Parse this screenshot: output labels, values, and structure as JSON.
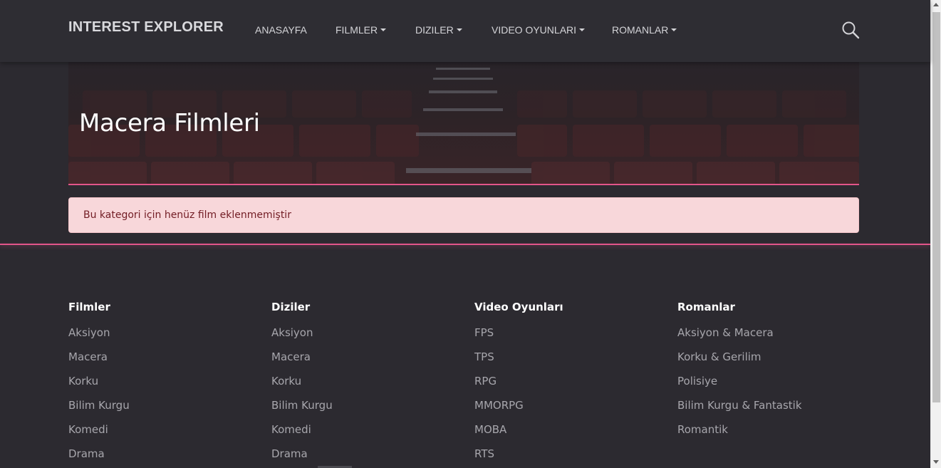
{
  "navbar": {
    "brand": "INTEREST EXPLORER",
    "items": [
      {
        "label": "ANASAYFA",
        "dropdown": false
      },
      {
        "label": "FILMLER",
        "dropdown": true
      },
      {
        "label": "DIZILER",
        "dropdown": true
      },
      {
        "label": "VIDEO OYUNLARI",
        "dropdown": true
      },
      {
        "label": "ROMANLAR",
        "dropdown": true
      }
    ],
    "search_icon": "search-icon"
  },
  "hero": {
    "title": "Macera Filmleri"
  },
  "alert": {
    "text": "Bu kategori için henüz film eklenmemiştir"
  },
  "footer": {
    "columns": [
      {
        "heading": "Filmler",
        "links": [
          "Aksiyon",
          "Macera",
          "Korku",
          "Bilim Kurgu",
          "Komedi",
          "Drama"
        ]
      },
      {
        "heading": "Diziler",
        "links": [
          "Aksiyon",
          "Macera",
          "Korku",
          "Bilim Kurgu",
          "Komedi",
          "Drama"
        ]
      },
      {
        "heading": "Video Oyunları",
        "links": [
          "FPS",
          "TPS",
          "RPG",
          "MMORPG",
          "MOBA",
          "RTS"
        ]
      },
      {
        "heading": "Romanlar",
        "links": [
          "Aksiyon & Macera",
          "Korku & Gerilim",
          "Polisiye",
          "Bilim Kurgu & Fantastik",
          "Romantik"
        ]
      }
    ]
  },
  "colors": {
    "background": "#2c2a30",
    "navbar": "#2e2d33",
    "accent": "#e2558a",
    "alert_bg": "#f8d7da",
    "alert_text": "#721c24"
  }
}
